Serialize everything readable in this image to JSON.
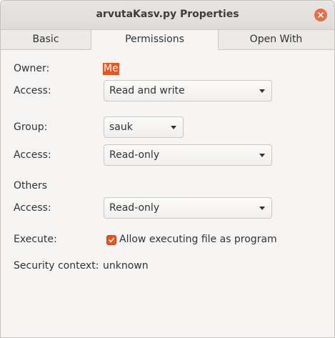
{
  "window": {
    "title": "arvutaKasv.py Properties"
  },
  "tabs": [
    {
      "label": "Basic"
    },
    {
      "label": "Permissions"
    },
    {
      "label": "Open With"
    }
  ],
  "owner": {
    "label": "Owner:",
    "value": "Me",
    "access_label": "Access:",
    "access_value": "Read and write"
  },
  "group": {
    "label": "Group:",
    "value": "sauk",
    "access_label": "Access:",
    "access_value": "Read-only"
  },
  "others": {
    "label": "Others",
    "access_label": "Access:",
    "access_value": "Read-only"
  },
  "execute": {
    "label": "Execute:",
    "checkbox_label": "Allow executing file as program",
    "checked": true
  },
  "security": {
    "label": "Security context:",
    "value": "unknown"
  },
  "colors": {
    "accent": "#e95420",
    "close": "#e96c4b",
    "background": "#f6f5f4"
  }
}
